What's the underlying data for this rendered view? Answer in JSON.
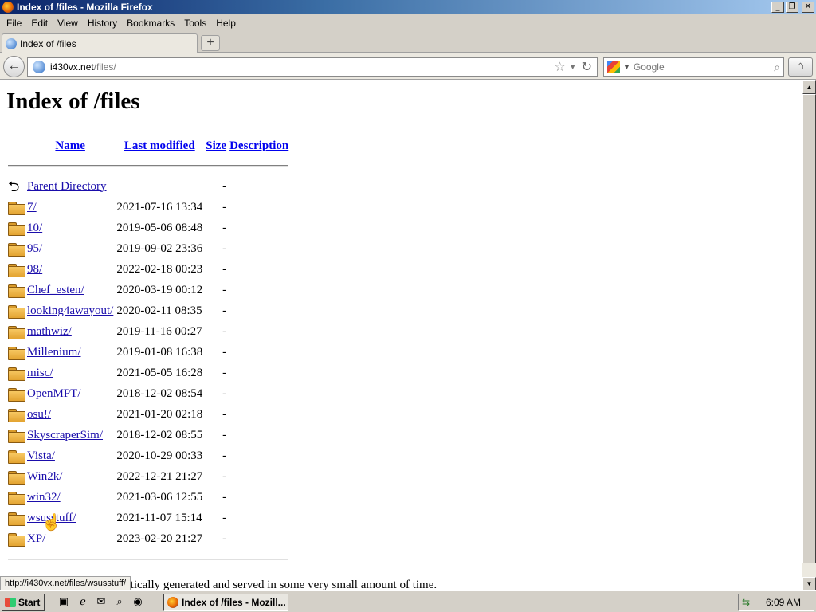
{
  "window": {
    "title": "Index of /files - Mozilla Firefox"
  },
  "menu": [
    "File",
    "Edit",
    "View",
    "History",
    "Bookmarks",
    "Tools",
    "Help"
  ],
  "tab": {
    "label": "Index of /files",
    "new_tab": "+"
  },
  "nav": {
    "url_host": "i430vx.net",
    "url_path": "/files/",
    "search_placeholder": "Google"
  },
  "page": {
    "heading": "Index of /files",
    "columns": {
      "name": "Name",
      "last_modified": "Last modified",
      "size": "Size",
      "description": "Description"
    },
    "parent": {
      "name": "Parent Directory",
      "size": "-"
    },
    "entries": [
      {
        "name": "7/",
        "modified": "2021-07-16 13:34",
        "size": "-"
      },
      {
        "name": "10/",
        "modified": "2019-05-06 08:48",
        "size": "-"
      },
      {
        "name": "95/",
        "modified": "2019-09-02 23:36",
        "size": "-"
      },
      {
        "name": "98/",
        "modified": "2022-02-18 00:23",
        "size": "-"
      },
      {
        "name": "Chef_esten/",
        "modified": "2020-03-19 00:12",
        "size": "-"
      },
      {
        "name": "looking4awayout/",
        "modified": "2020-02-11 08:35",
        "size": "-"
      },
      {
        "name": "mathwiz/",
        "modified": "2019-11-16 00:27",
        "size": "-"
      },
      {
        "name": "Millenium/",
        "modified": "2019-01-08 16:38",
        "size": "-"
      },
      {
        "name": "misc/",
        "modified": "2021-05-05 16:28",
        "size": "-"
      },
      {
        "name": "OpenMPT/",
        "modified": "2018-12-02 08:54",
        "size": "-"
      },
      {
        "name": "osu!/",
        "modified": "2021-01-20 02:18",
        "size": "-"
      },
      {
        "name": "SkyscraperSim/",
        "modified": "2018-12-02 08:55",
        "size": "-"
      },
      {
        "name": "Vista/",
        "modified": "2020-10-29 00:33",
        "size": "-"
      },
      {
        "name": "Win2k/",
        "modified": "2022-12-21 21:27",
        "size": "-"
      },
      {
        "name": "win32/",
        "modified": "2021-03-06 12:55",
        "size": "-"
      },
      {
        "name": "wsusstuff/",
        "modified": "2021-11-07 15:14",
        "size": "-"
      },
      {
        "name": "XP/",
        "modified": "2023-02-20 21:27",
        "size": "-"
      }
    ],
    "footer": "atically generated and served in some very small amount of time."
  },
  "status_url": "http://i430vx.net/files/wsusstuff/",
  "taskbar": {
    "start": "Start",
    "task_label": "Index of /files - Mozill...",
    "clock": "6:09 AM"
  },
  "icons": {
    "parent": "back-arrow-icon",
    "entry": "folder-icon",
    "folder_color": "#e3a331"
  }
}
